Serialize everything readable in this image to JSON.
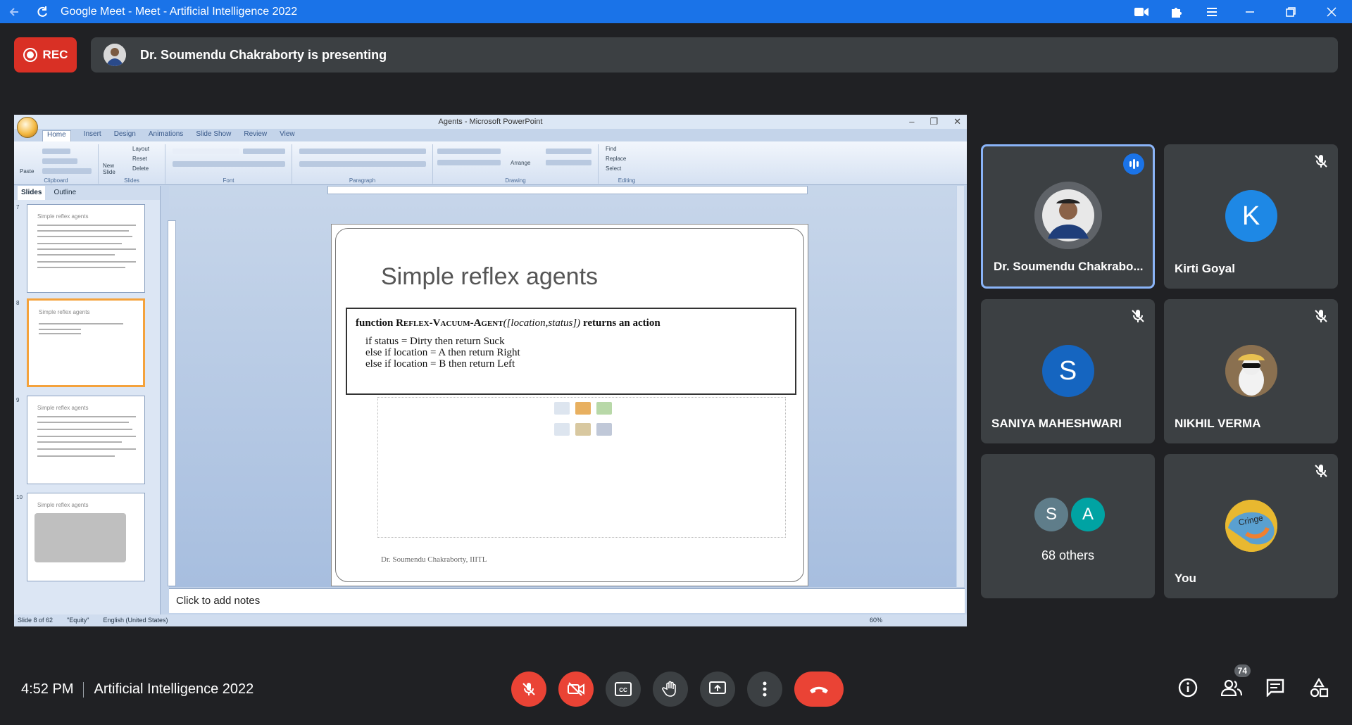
{
  "window": {
    "title": "Google Meet - Meet - Artificial Intelligence 2022"
  },
  "rec_label": "REC",
  "presenting_text": "Dr. Soumendu Chakraborty is presenting",
  "ppt": {
    "window_title": "Agents - Microsoft PowerPoint",
    "tabs": [
      "Home",
      "Insert",
      "Design",
      "Animations",
      "Slide Show",
      "Review",
      "View"
    ],
    "ribbon_groups": [
      "Clipboard",
      "Slides",
      "Font",
      "Paragraph",
      "Drawing",
      "Editing"
    ],
    "ribbon_buttons": {
      "paste": "Paste",
      "new_slide": "New Slide",
      "layout": "Layout",
      "reset": "Reset",
      "delete": "Delete",
      "arrange": "Arrange",
      "find": "Find",
      "replace": "Replace",
      "select": "Select"
    },
    "side_tabs": [
      "Slides",
      "Outline"
    ],
    "thumbnails": [
      {
        "num": "7",
        "title": "Simple reflex agents"
      },
      {
        "num": "8",
        "title": "Simple reflex agents"
      },
      {
        "num": "9",
        "title": "Simple reflex agents"
      },
      {
        "num": "10",
        "title": "Simple reflex agents"
      }
    ],
    "slide": {
      "title": "Simple reflex agents",
      "algo": {
        "line1_prefix": "function",
        "line1_name": "Reflex-Vacuum-Agent",
        "line1_args": "([location,status])",
        "line1_suffix": "returns an action",
        "line2": "if status = Dirty then return Suck",
        "line3": "else if location = A then return Right",
        "line4": "else if location = B then return Left"
      },
      "footer": "Dr. Soumendu Chakraborty, IIITL"
    },
    "notes_placeholder": "Click to add notes",
    "status": {
      "slide_of": "Slide 8 of 62",
      "theme": "\"Equity\"",
      "language": "English (United States)",
      "zoom": "60%"
    }
  },
  "participants": [
    {
      "name": "Dr. Soumendu Chakrabo...",
      "type": "photo",
      "speaking": true,
      "muted": false
    },
    {
      "name": "Kirti Goyal",
      "initial": "K",
      "color": "#1e88e5",
      "muted": true
    },
    {
      "name": "SANIYA MAHESHWARI",
      "initial": "S",
      "color": "#1565c0",
      "muted": true
    },
    {
      "name": "NIKHIL VERMA",
      "type": "photo",
      "muted": true
    },
    {
      "others_label": "68 others",
      "avatars": [
        {
          "initial": "S",
          "color": "#5f7d8a"
        },
        {
          "initial": "A",
          "color": "#00a3a3"
        }
      ]
    },
    {
      "name": "You",
      "type": "sticker",
      "sticker_text": "Cringe",
      "muted": true
    }
  ],
  "bottom": {
    "time": "4:52 PM",
    "meeting_name": "Artificial Intelligence 2022",
    "people_count": "74"
  },
  "colors": {
    "titlebar": "#1a73e8",
    "background": "#202124",
    "tile": "#3c4043",
    "red": "#ea4335"
  }
}
